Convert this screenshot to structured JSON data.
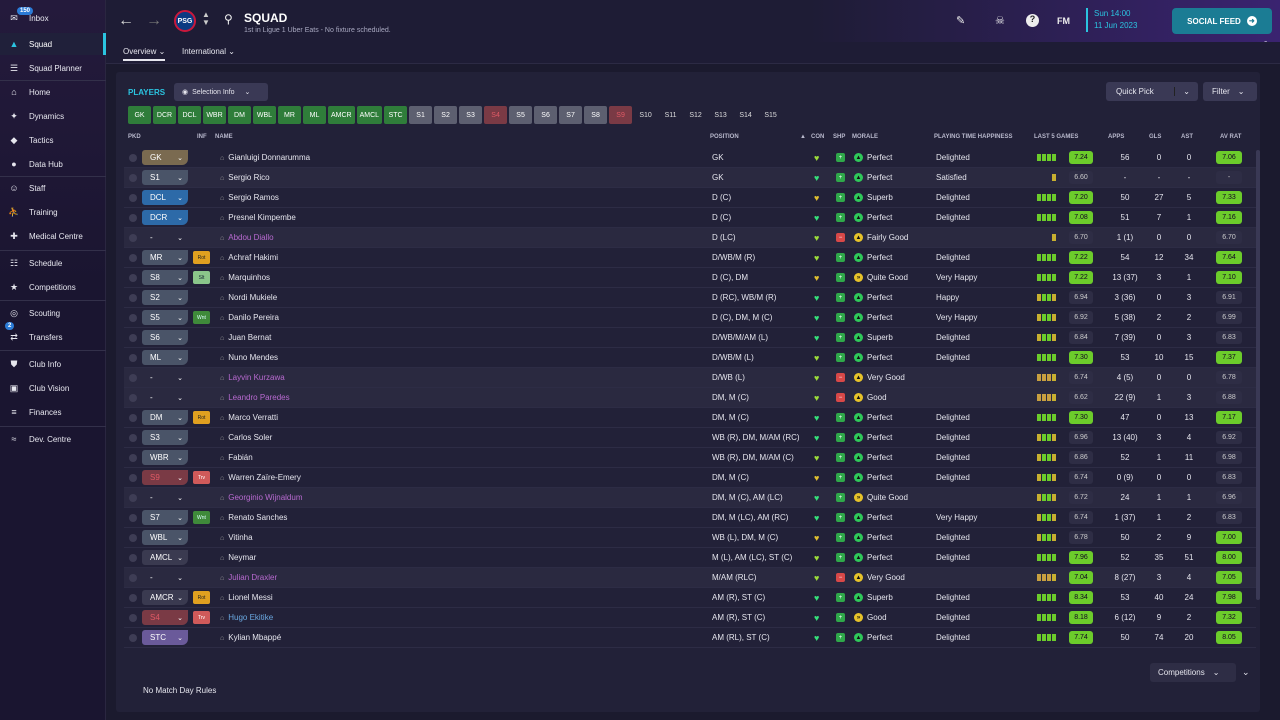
{
  "sidebar": {
    "inbox_badge": "150",
    "transfers_badge": "2",
    "items": [
      {
        "label": "Inbox",
        "icon": "inbox-icon"
      },
      {
        "label": "Squad",
        "icon": "shirt-icon"
      },
      {
        "label": "Squad Planner",
        "icon": "planner-icon"
      },
      {
        "label": "Home",
        "icon": "home-icon"
      },
      {
        "label": "Dynamics",
        "icon": "dynamics-icon"
      },
      {
        "label": "Tactics",
        "icon": "tactics-icon"
      },
      {
        "label": "Data Hub",
        "icon": "data-hub-icon"
      },
      {
        "label": "Staff",
        "icon": "staff-icon"
      },
      {
        "label": "Training",
        "icon": "training-icon"
      },
      {
        "label": "Medical Centre",
        "icon": "medical-icon"
      },
      {
        "label": "Schedule",
        "icon": "calendar-icon"
      },
      {
        "label": "Competitions",
        "icon": "trophy-icon"
      },
      {
        "label": "Scouting",
        "icon": "scouting-icon"
      },
      {
        "label": "Transfers",
        "icon": "transfers-icon"
      },
      {
        "label": "Club Info",
        "icon": "shield-icon"
      },
      {
        "label": "Club Vision",
        "icon": "vision-icon"
      },
      {
        "label": "Finances",
        "icon": "finances-icon"
      },
      {
        "label": "Dev. Centre",
        "icon": "dev-centre-icon"
      }
    ]
  },
  "header": {
    "title": "SQUAD",
    "subtitle": "1st in Ligue 1 Uber Eats - No fixture scheduled.",
    "date_line1": "Sun 14:00",
    "date_line2": "11 Jun 2023",
    "fm_label": "FM",
    "social_feed": "SOCIAL FEED",
    "notifications": "5"
  },
  "tabs": {
    "overview": "Overview",
    "international": "International"
  },
  "toolbar": {
    "players": "PLAYERS",
    "selection_info": "Selection Info",
    "quick_pick": "Quick Pick",
    "filter": "Filter",
    "competitions": "Competitions",
    "no_match_rules": "No Match Day Rules"
  },
  "position_buttons": [
    {
      "label": "GK",
      "style": "g"
    },
    {
      "label": "DCR",
      "style": "g"
    },
    {
      "label": "DCL",
      "style": "g"
    },
    {
      "label": "WBR",
      "style": "g"
    },
    {
      "label": "DM",
      "style": "g"
    },
    {
      "label": "WBL",
      "style": "g"
    },
    {
      "label": "MR",
      "style": "g"
    },
    {
      "label": "ML",
      "style": "g"
    },
    {
      "label": "AMCR",
      "style": "g"
    },
    {
      "label": "AMCL",
      "style": "g"
    },
    {
      "label": "STC",
      "style": "g"
    },
    {
      "label": "S1",
      "style": "s"
    },
    {
      "label": "S2",
      "style": "s"
    },
    {
      "label": "S3",
      "style": "s"
    },
    {
      "label": "S4",
      "style": "r"
    },
    {
      "label": "S5",
      "style": "s"
    },
    {
      "label": "S6",
      "style": "s"
    },
    {
      "label": "S7",
      "style": "s"
    },
    {
      "label": "S8",
      "style": "s"
    },
    {
      "label": "S9",
      "style": "r"
    },
    {
      "label": "S10",
      "style": "d"
    },
    {
      "label": "S11",
      "style": "d"
    },
    {
      "label": "S12",
      "style": "d"
    },
    {
      "label": "S13",
      "style": "d"
    },
    {
      "label": "S14",
      "style": "d"
    },
    {
      "label": "S15",
      "style": "d"
    }
  ],
  "columns": {
    "pkd": "PKD",
    "inf": "INF",
    "name": "NAME",
    "position": "POSITION",
    "con": "CON",
    "shp": "SHP",
    "morale": "MORALE",
    "pth": "PLAYING TIME HAPPINESS",
    "last5": "LAST 5 GAMES",
    "apps": "APPS",
    "gls": "GLS",
    "ast": "AST",
    "avrat": "AV RAT"
  },
  "players": [
    {
      "pkd": "GK",
      "pkd_color": "#7a6a50",
      "inf": "",
      "name": "Gianluigi Donnarumma",
      "position": "GK",
      "morale": "Perfect",
      "pth": "Delighted",
      "last5": "7.24",
      "apps": "56",
      "gls": "0",
      "ast": "0",
      "avrat": "7.06",
      "mood": "good"
    },
    {
      "pkd": "S1",
      "pkd_color": "#4a5468",
      "inf": "",
      "name": "Sergio Rico",
      "position": "GK",
      "morale": "Perfect",
      "pth": "Satisfied",
      "last5": "6.60",
      "apps": "-",
      "gls": "-",
      "ast": "-",
      "avrat": "-",
      "mood": "good"
    },
    {
      "pkd": "DCL",
      "pkd_color": "#2d6aa8",
      "inf": "",
      "name": "Sergio Ramos",
      "position": "D (C)",
      "morale": "Superb",
      "pth": "Delighted",
      "last5": "7.20",
      "apps": "50",
      "gls": "27",
      "ast": "5",
      "avrat": "7.33",
      "mood": "good"
    },
    {
      "pkd": "DCR",
      "pkd_color": "#2d6aa8",
      "inf": "",
      "name": "Presnel Kimpembe",
      "position": "D (C)",
      "morale": "Perfect",
      "pth": "Delighted",
      "last5": "7.08",
      "apps": "51",
      "gls": "7",
      "ast": "1",
      "avrat": "7.16",
      "mood": "good"
    },
    {
      "pkd": "-",
      "pkd_color": "transparent",
      "inf": "",
      "name": "Abdou Diallo",
      "name_style": "loan",
      "position": "D (LC)",
      "morale": "Fairly Good",
      "pth": "",
      "last5": "6.70",
      "apps": "1 (1)",
      "gls": "0",
      "ast": "0",
      "avrat": "6.70",
      "mood": "bad"
    },
    {
      "pkd": "MR",
      "pkd_color": "#4a5468",
      "inf": "Rot",
      "name": "Achraf Hakimi",
      "position": "D/WB/M (R)",
      "morale": "Perfect",
      "pth": "Delighted",
      "last5": "7.22",
      "apps": "54",
      "gls": "12",
      "ast": "34",
      "avrat": "7.64",
      "mood": "good"
    },
    {
      "pkd": "S8",
      "pkd_color": "#4a5468",
      "inf": "Slt",
      "name": "Marquinhos",
      "position": "D (C), DM",
      "morale": "Quite Good",
      "pth": "Very Happy",
      "last5": "7.22",
      "apps": "13 (37)",
      "gls": "3",
      "ast": "1",
      "avrat": "7.10",
      "mood": "ok"
    },
    {
      "pkd": "S2",
      "pkd_color": "#4a5468",
      "inf": "",
      "name": "Nordi Mukiele",
      "position": "D (RC), WB/M (R)",
      "morale": "Perfect",
      "pth": "Happy",
      "last5": "6.94",
      "apps": "3 (36)",
      "gls": "0",
      "ast": "3",
      "avrat": "6.91",
      "mood": "good"
    },
    {
      "pkd": "S5",
      "pkd_color": "#4a5468",
      "inf": "Wnt",
      "name": "Danilo Pereira",
      "position": "D (C), DM, M (C)",
      "morale": "Perfect",
      "pth": "Very Happy",
      "last5": "6.92",
      "apps": "5 (38)",
      "gls": "2",
      "ast": "2",
      "avrat": "6.99",
      "mood": "good"
    },
    {
      "pkd": "S6",
      "pkd_color": "#4a5468",
      "inf": "",
      "name": "Juan Bernat",
      "position": "D/WB/M/AM (L)",
      "morale": "Superb",
      "pth": "Delighted",
      "last5": "6.84",
      "apps": "7 (39)",
      "gls": "0",
      "ast": "3",
      "avrat": "6.83",
      "mood": "good"
    },
    {
      "pkd": "ML",
      "pkd_color": "#4a5468",
      "inf": "",
      "name": "Nuno Mendes",
      "position": "D/WB/M (L)",
      "morale": "Perfect",
      "pth": "Delighted",
      "last5": "7.30",
      "apps": "53",
      "gls": "10",
      "ast": "15",
      "avrat": "7.37",
      "mood": "good"
    },
    {
      "pkd": "-",
      "pkd_color": "transparent",
      "inf": "",
      "name": "Layvin Kurzawa",
      "name_style": "loan",
      "position": "D/WB (L)",
      "morale": "Very Good",
      "pth": "",
      "last5": "6.74",
      "apps": "4 (5)",
      "gls": "0",
      "ast": "0",
      "avrat": "6.78",
      "mood": "bad"
    },
    {
      "pkd": "-",
      "pkd_color": "transparent",
      "inf": "",
      "name": "Leandro Paredes",
      "name_style": "loan",
      "position": "DM, M (C)",
      "morale": "Good",
      "pth": "",
      "last5": "6.62",
      "apps": "22 (9)",
      "gls": "1",
      "ast": "3",
      "avrat": "6.88",
      "mood": "bad"
    },
    {
      "pkd": "DM",
      "pkd_color": "#4a5468",
      "inf": "Rot",
      "name": "Marco Verratti",
      "position": "DM, M (C)",
      "morale": "Perfect",
      "pth": "Delighted",
      "last5": "7.30",
      "apps": "47",
      "gls": "0",
      "ast": "13",
      "avrat": "7.17",
      "mood": "good"
    },
    {
      "pkd": "S3",
      "pkd_color": "#4a5468",
      "inf": "",
      "name": "Carlos Soler",
      "position": "WB (R), DM, M/AM (RC)",
      "morale": "Perfect",
      "pth": "Delighted",
      "last5": "6.96",
      "apps": "13 (40)",
      "gls": "3",
      "ast": "4",
      "avrat": "6.92",
      "mood": "good"
    },
    {
      "pkd": "WBR",
      "pkd_color": "#4a5468",
      "inf": "",
      "name": "Fabián",
      "position": "WB (R), DM, M/AM (C)",
      "morale": "Perfect",
      "pth": "Delighted",
      "last5": "6.86",
      "apps": "52",
      "gls": "1",
      "ast": "11",
      "avrat": "6.98",
      "mood": "good"
    },
    {
      "pkd": "S9",
      "pkd_color": "#7a3a45",
      "inf": "Trv",
      "name": "Warren Zaïre-Emery",
      "position": "DM, M (C)",
      "morale": "Perfect",
      "pth": "Delighted",
      "last5": "6.74",
      "apps": "0 (9)",
      "gls": "0",
      "ast": "0",
      "avrat": "6.83",
      "mood": "good"
    },
    {
      "pkd": "-",
      "pkd_color": "transparent",
      "inf": "",
      "name": "Georginio Wijnaldum",
      "name_style": "loan",
      "position": "DM, M (C), AM (LC)",
      "morale": "Quite Good",
      "pth": "",
      "last5": "6.72",
      "apps": "24",
      "gls": "1",
      "ast": "1",
      "avrat": "6.96",
      "mood": "ok"
    },
    {
      "pkd": "S7",
      "pkd_color": "#4a5468",
      "inf": "Wnt",
      "name": "Renato Sanches",
      "position": "DM, M (LC), AM (RC)",
      "morale": "Perfect",
      "pth": "Very Happy",
      "last5": "6.74",
      "apps": "1 (37)",
      "gls": "1",
      "ast": "2",
      "avrat": "6.83",
      "mood": "good"
    },
    {
      "pkd": "WBL",
      "pkd_color": "#4a5468",
      "inf": "",
      "name": "Vitinha",
      "position": "WB (L), DM, M (C)",
      "morale": "Perfect",
      "pth": "Delighted",
      "last5": "6.78",
      "apps": "50",
      "gls": "2",
      "ast": "9",
      "avrat": "7.00",
      "mood": "good"
    },
    {
      "pkd": "AMCL",
      "pkd_color": "#3a3a50",
      "inf": "",
      "name": "Neymar",
      "position": "M (L), AM (LC), ST (C)",
      "morale": "Perfect",
      "pth": "Delighted",
      "last5": "7.96",
      "apps": "52",
      "gls": "35",
      "ast": "51",
      "avrat": "8.00",
      "mood": "good"
    },
    {
      "pkd": "-",
      "pkd_color": "transparent",
      "inf": "",
      "name": "Julian Draxler",
      "name_style": "loan",
      "position": "M/AM (RLC)",
      "morale": "Very Good",
      "pth": "",
      "last5": "7.04",
      "apps": "8 (27)",
      "gls": "3",
      "ast": "4",
      "avrat": "7.05",
      "mood": "bad"
    },
    {
      "pkd": "AMCR",
      "pkd_color": "#3a3a50",
      "inf": "Rot",
      "name": "Lionel Messi",
      "position": "AM (R), ST (C)",
      "morale": "Superb",
      "pth": "Delighted",
      "last5": "8.34",
      "apps": "53",
      "gls": "40",
      "ast": "24",
      "avrat": "7.98",
      "mood": "good"
    },
    {
      "pkd": "S4",
      "pkd_color": "#7a3a45",
      "inf": "Trv",
      "name": "Hugo Ekitike",
      "name_style": "loanblue",
      "position": "AM (R), ST (C)",
      "morale": "Good",
      "pth": "Delighted",
      "last5": "8.18",
      "apps": "6 (12)",
      "gls": "9",
      "ast": "2",
      "avrat": "7.32",
      "mood": "ok"
    },
    {
      "pkd": "STC",
      "pkd_color": "#6a5a9a",
      "inf": "",
      "name": "Kylian Mbappé",
      "position": "AM (RL), ST (C)",
      "morale": "Perfect",
      "pth": "Delighted",
      "last5": "7.74",
      "apps": "50",
      "gls": "74",
      "ast": "20",
      "avrat": "8.05",
      "mood": "good"
    }
  ]
}
